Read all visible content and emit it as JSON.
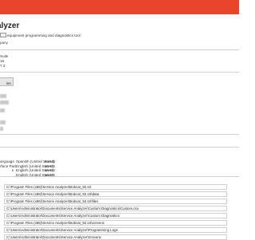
{
  "app": {
    "title": "alyzer",
    "description": "equipment programming and diagnostics tool",
    "company": "pany"
  },
  "info": {
    "lines": [
      "Suite",
      "16",
      "7.3"
    ]
  },
  "action_button": {
    "label": "ion"
  },
  "languages": {
    "rows": [
      {
        "label": "anguage",
        "name": "Spanish (United States)",
        "code": "en-US"
      },
      {
        "label": "rface Pack",
        "name": "English (United States)",
        "code": "en-US"
      },
      {
        "label": "s",
        "name": "English (United States)",
        "code": "en-US"
      },
      {
        "label": "",
        "name": "English (United States)",
        "code": "en-US"
      }
    ]
  },
  "paths": [
    "C:\\Program Files (x86)\\Service Analyzer\\Bobcat_92.16",
    "C:\\Program Files (x86)\\Service Analyzer\\Bobcat_92.16\\data",
    "C:\\Program Files (x86)\\Service Analyzer\\Bobcat_92.16\\files",
    "C:\\Users\\Administrator\\Documents\\Service Analyzer\\Custom Diagnostics\\Custom.csv",
    "C:\\Users\\Administrator\\Documents\\Service Analyzer\\Custom Diagnostics",
    "C:\\Program Files (x86)\\Service Analyzer\\Bobcat_92.16\\screens",
    "C:\\Users\\Administrator\\Documents\\Service Analyzer\\Programming Logs",
    "C:\\Users\\Administrator\\Documents\\Service Analyzer\\Screens"
  ]
}
